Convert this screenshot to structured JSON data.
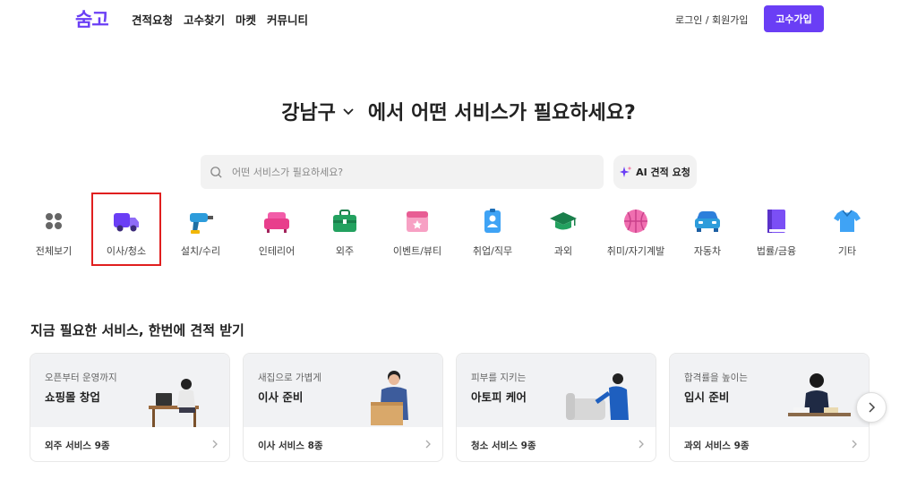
{
  "header": {
    "logo": "숨고",
    "nav": [
      "견적요청",
      "고수찾기",
      "마켓",
      "커뮤니티"
    ],
    "login": "로그인 / 회원가입",
    "pro_join": "고수가입"
  },
  "hero": {
    "region": "강남구",
    "text": "에서 어떤 서비스가 필요하세요?"
  },
  "search": {
    "placeholder": "어떤 서비스가 필요하세요?",
    "ai_button": "AI 견적 요청"
  },
  "categories": [
    {
      "label": "전체보기",
      "icon": "grid-icon"
    },
    {
      "label": "이사/청소",
      "icon": "truck-icon"
    },
    {
      "label": "설치/수리",
      "icon": "drill-icon"
    },
    {
      "label": "인테리어",
      "icon": "sofa-icon"
    },
    {
      "label": "외주",
      "icon": "briefcase-icon"
    },
    {
      "label": "이벤트/뷰티",
      "icon": "calendar-icon"
    },
    {
      "label": "취업/직무",
      "icon": "id-badge-icon"
    },
    {
      "label": "과외",
      "icon": "graduation-cap-icon"
    },
    {
      "label": "취미/자기계발",
      "icon": "basketball-icon"
    },
    {
      "label": "자동차",
      "icon": "car-icon"
    },
    {
      "label": "법률/금융",
      "icon": "book-icon"
    },
    {
      "label": "기타",
      "icon": "shirt-icon"
    }
  ],
  "selected_category": "이사/청소",
  "section": {
    "title": "지금 필요한 서비스, 한번에 견적 받기",
    "cards": [
      {
        "subtitle": "오픈부터 운영까지",
        "title": "쇼핑몰 창업",
        "footer": "외주 서비스 9종"
      },
      {
        "subtitle": "새집으로 가볍게",
        "title": "이사 준비",
        "footer": "이사 서비스 8종"
      },
      {
        "subtitle": "피부를 지키는",
        "title": "아토피 케어",
        "footer": "청소 서비스 9종"
      },
      {
        "subtitle": "합격률을 높이는",
        "title": "입시 준비",
        "footer": "과외 서비스 9종"
      }
    ]
  },
  "colors": {
    "brand": "#6a3ef5",
    "highlight": "#e01f1f"
  }
}
